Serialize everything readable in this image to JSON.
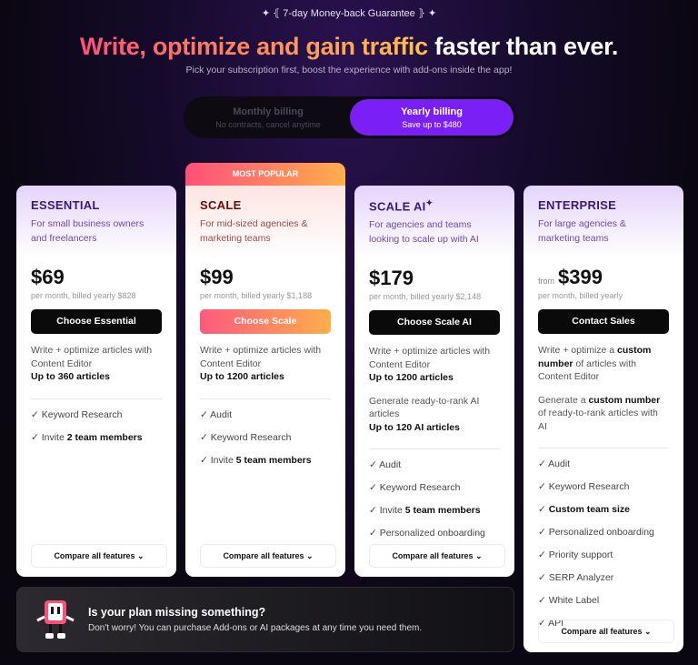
{
  "header": {
    "guarantee": "7-day Money-back Guarantee",
    "title_gradient": "Write, optimize and gain traffic",
    "title_white": "faster than ever.",
    "subtitle": "Pick your subscription first, boost the experience with add-ons inside the app!"
  },
  "billing": {
    "monthly": {
      "label": "Monthly billing",
      "sub": "No contracts, cancel anytime",
      "selected": false
    },
    "yearly": {
      "label": "Yearly billing",
      "sub": "Save up to $480",
      "selected": true
    }
  },
  "popular_badge": "MOST POPULAR",
  "compare_label": "Compare all features",
  "colors": {
    "accent": "#7a1ff5",
    "gradient_start": "#ff4f7b",
    "gradient_end": "#ffae4a"
  },
  "plans": [
    {
      "name": "ESSENTIAL",
      "desc": "For small business owners and freelancers",
      "from": "",
      "price": "$69",
      "note": "per month, billed yearly $828",
      "button": "Choose Essential",
      "blocks": [
        [
          {
            "t": "Write + optimize articles with Content Editor"
          },
          {
            "t": "Up to 360 articles",
            "b": true,
            "br": true
          }
        ]
      ],
      "features": [
        [
          {
            "t": "✓ Keyword Research"
          }
        ],
        [
          {
            "t": "✓ Invite "
          },
          {
            "t": "2 team members",
            "b": true
          }
        ]
      ]
    },
    {
      "name": "SCALE",
      "desc": "For mid-sized agencies & marketing teams",
      "from": "",
      "price": "$99",
      "note": "per month, billed yearly $1,188",
      "button": "Choose Scale",
      "blocks": [
        [
          {
            "t": "Write + optimize articles with Content Editor"
          },
          {
            "t": "Up to 1200 articles",
            "b": true,
            "br": true
          }
        ]
      ],
      "features": [
        [
          {
            "t": "✓ Audit"
          }
        ],
        [
          {
            "t": "✓ Keyword Research"
          }
        ],
        [
          {
            "t": "✓ Invite "
          },
          {
            "t": "5 team members",
            "b": true
          }
        ]
      ]
    },
    {
      "name": "SCALE AI",
      "desc": "For agencies and teams looking to scale up with AI",
      "from": "",
      "price": "$179",
      "note": "per month, billed yearly $2,148",
      "button": "Choose Scale AI",
      "blocks": [
        [
          {
            "t": "Write + optimize articles with Content Editor"
          },
          {
            "t": "Up to 1200 articles",
            "b": true,
            "br": true
          }
        ],
        [
          {
            "t": "Generate ready-to-rank AI articles"
          },
          {
            "t": "Up to 120 AI articles",
            "b": true,
            "br": true
          }
        ]
      ],
      "features": [
        [
          {
            "t": "✓ Audit"
          }
        ],
        [
          {
            "t": "✓ Keyword Research"
          }
        ],
        [
          {
            "t": "✓ Invite "
          },
          {
            "t": "5 team members",
            "b": true
          }
        ],
        [
          {
            "t": "✓ Personalized onboarding"
          }
        ]
      ]
    },
    {
      "name": "ENTERPRISE",
      "desc": "For large agencies & marketing teams",
      "from": "from",
      "price": "$399",
      "note": "per month, billed yearly",
      "button": "Contact Sales",
      "blocks": [
        [
          {
            "t": "Write + optimize a "
          },
          {
            "t": "custom number",
            "b": true
          },
          {
            "t": " of articles with Content Editor"
          }
        ],
        [
          {
            "t": "Generate a "
          },
          {
            "t": "custom number",
            "b": true
          },
          {
            "t": " of ready-to-rank articles with AI"
          }
        ]
      ],
      "features": [
        [
          {
            "t": "✓ Audit"
          }
        ],
        [
          {
            "t": "✓ Keyword Research"
          }
        ],
        [
          {
            "t": "✓ "
          },
          {
            "t": "Custom team size",
            "b": true
          }
        ],
        [
          {
            "t": "✓ Personalized onboarding"
          }
        ],
        [
          {
            "t": "✓ Priority support"
          }
        ],
        [
          {
            "t": "✓ SERP Analyzer"
          }
        ],
        [
          {
            "t": "✓ White Label"
          }
        ],
        [
          {
            "t": "✓ API"
          }
        ]
      ]
    }
  ],
  "banner": {
    "title": "Is your plan missing something?",
    "text": "Don't worry! You can purchase Add-ons or AI packages at any time you need them."
  }
}
